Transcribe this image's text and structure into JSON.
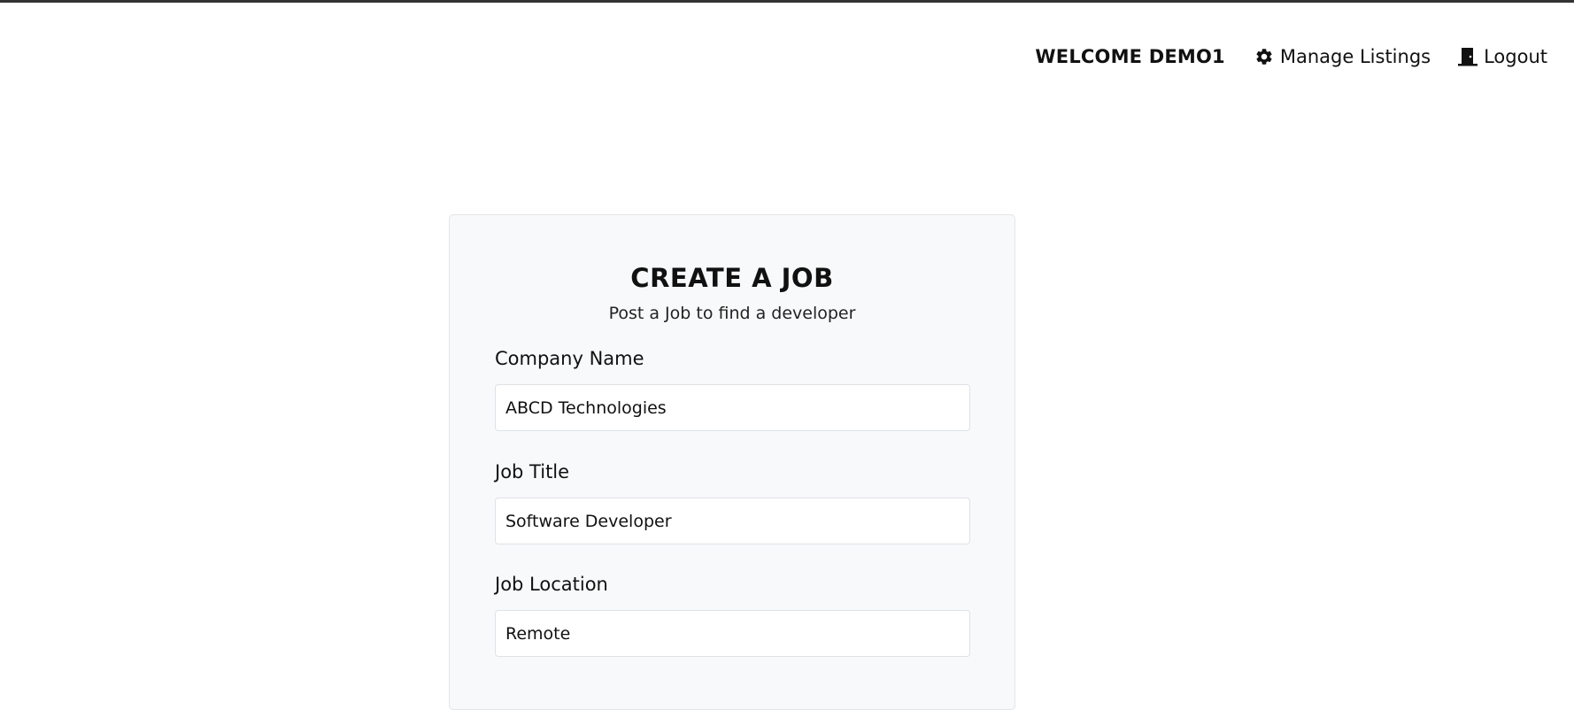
{
  "nav": {
    "welcome": "WELCOME DEMO1",
    "manage_listings": "Manage Listings",
    "logout": "Logout"
  },
  "form": {
    "title": "CREATE A JOB",
    "subtitle": "Post a Job to find a developer",
    "fields": [
      {
        "label": "Company Name",
        "value": "ABCD Technologies"
      },
      {
        "label": "Job Title",
        "value": "Software Developer"
      },
      {
        "label": "Job Location",
        "value": "Remote"
      }
    ]
  },
  "icons": {
    "manage": "gear-icon",
    "logout": "door-icon"
  }
}
